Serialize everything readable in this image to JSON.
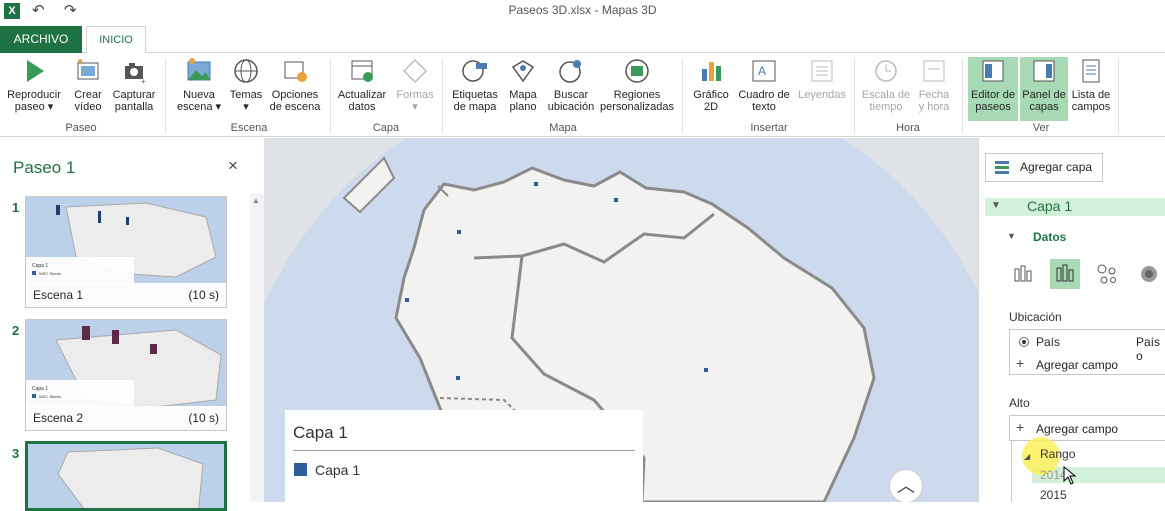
{
  "window": {
    "title": "Paseos 3D.xlsx - Mapas 3D",
    "app_icon": "excel-icon",
    "quick_access": [
      "undo-icon",
      "redo-icon"
    ]
  },
  "tabs": {
    "file": "ARCHIVO",
    "home": "INICIO"
  },
  "ribbon": {
    "groups": {
      "paseo": "Paseo",
      "escena": "Escena",
      "capa": "Capa",
      "mapa": "Mapa",
      "insertar": "Insertar",
      "hora": "Hora",
      "ver": "Ver"
    },
    "buttons": {
      "play": [
        "Reproducir",
        "paseo ▾"
      ],
      "video": [
        "Crear",
        "vídeo"
      ],
      "capture": [
        "Capturar",
        "pantalla"
      ],
      "new_scene": [
        "Nueva",
        "escena ▾"
      ],
      "themes": [
        "Temas",
        "▾"
      ],
      "scene_opts": [
        "Opciones",
        "de escena"
      ],
      "refresh": [
        "Actualizar",
        "datos"
      ],
      "shapes": [
        "Formas",
        "▾"
      ],
      "map_labels": [
        "Etiquetas",
        "de mapa"
      ],
      "flat_map": [
        "Mapa",
        "plano"
      ],
      "find_loc": [
        "Buscar",
        "ubicación"
      ],
      "custom_regions": [
        "Regiones",
        "personalizadas"
      ],
      "chart2d": [
        "Gráfico",
        "2D"
      ],
      "textbox": [
        "Cuadro de",
        "texto"
      ],
      "legends": [
        "Leyendas",
        ""
      ],
      "timeline": [
        "Escala de",
        "tiempo"
      ],
      "datetime": [
        "Fecha",
        "y hora"
      ],
      "tour_editor": [
        "Editor de",
        "paseos"
      ],
      "layer_pane": [
        "Panel de",
        "capas"
      ],
      "field_list": [
        "Lista de",
        "campos"
      ]
    }
  },
  "tour_panel": {
    "title": "Paseo 1",
    "close": "×",
    "scenes": [
      {
        "num": "1",
        "name": "Escena 1",
        "duration": "(10 s)",
        "legend_title": "Capa 1",
        "legend_item": "WSC Stores"
      },
      {
        "num": "2",
        "name": "Escena 2",
        "duration": "(10 s)",
        "legend_title": "Capa 1",
        "legend_item": "WSC Stores"
      },
      {
        "num": "3",
        "name": "",
        "duration": ""
      }
    ]
  },
  "map": {
    "legend_title": "Capa 1",
    "legend_item": "Capa 1",
    "legend_color": "#2e5d9c",
    "up_button": "︿"
  },
  "layer_pane": {
    "add_layer": "Agregar capa",
    "layer_name": "Capa 1",
    "data_section": "Datos",
    "location_label": "Ubicación",
    "location_field": "País",
    "location_type": "País o",
    "add_field": "Agregar campo",
    "height_label": "Alto",
    "height_add_field": "Agregar campo",
    "range_label": "Rango",
    "years": [
      "2014",
      "2015"
    ]
  },
  "colors": {
    "accent": "#1f7244",
    "selected": "#a7d9b4",
    "layer_row": "#d3f0da",
    "ocean": "#dfe3e8"
  }
}
